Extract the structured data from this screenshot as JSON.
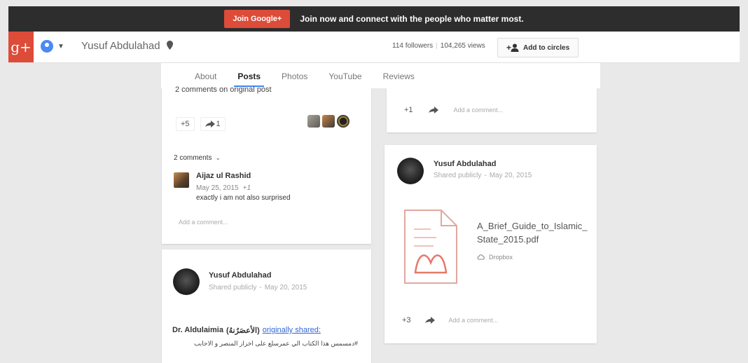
{
  "promo": {
    "join_label": "Join Google+",
    "message": "Join now and connect with the people who matter most."
  },
  "header": {
    "logo_text": "g+",
    "profile_name": "Yusuf Abdulahad",
    "followers": "114 followers",
    "views": "104,265 views",
    "add_to_circles": "Add to circles"
  },
  "tabs": [
    {
      "label": "About"
    },
    {
      "label": "Posts",
      "active": true
    },
    {
      "label": "Photos"
    },
    {
      "label": "YouTube"
    },
    {
      "label": "Reviews"
    }
  ],
  "left_card_1": {
    "comments_on_original": "2 comments on original post",
    "plus_count": "+5",
    "share_count": "1",
    "comments_toggle": "2 comments",
    "comment": {
      "author": "Aijaz ul Rashid",
      "date": "May 25, 2015",
      "plus": "+1",
      "text": "exactly i am not also surprised"
    },
    "add_comment": "Add a comment..."
  },
  "left_card_2": {
    "author": "Yusuf Abdulahad",
    "visibility": "Shared publicly",
    "date": "May 20, 2015",
    "sharer": "Dr. Aldulaimia",
    "sharer_arabic": "(الأعصَرُنهُ)",
    "originally_shared": "originally shared:",
    "arabic_text": "#دمسمس هذا الكتاب الي عمرسلع على اخزاز المنصر و الاحابب"
  },
  "right_card_1": {
    "plus_count": "+1",
    "add_comment": "Add a comment..."
  },
  "right_card_2": {
    "author": "Yusuf Abdulahad",
    "visibility": "Shared publicly",
    "date": "May 20, 2015",
    "file_name_line1": "A_Brief_Guide_to_Islamic_",
    "file_name_line2": "State_2015.pdf",
    "source": "Dropbox",
    "plus_count": "+3",
    "add_comment": "Add a comment..."
  },
  "colors": {
    "brand_red": "#dd4b39",
    "link_blue": "#3367d6",
    "tab_underline": "#4285f4"
  }
}
